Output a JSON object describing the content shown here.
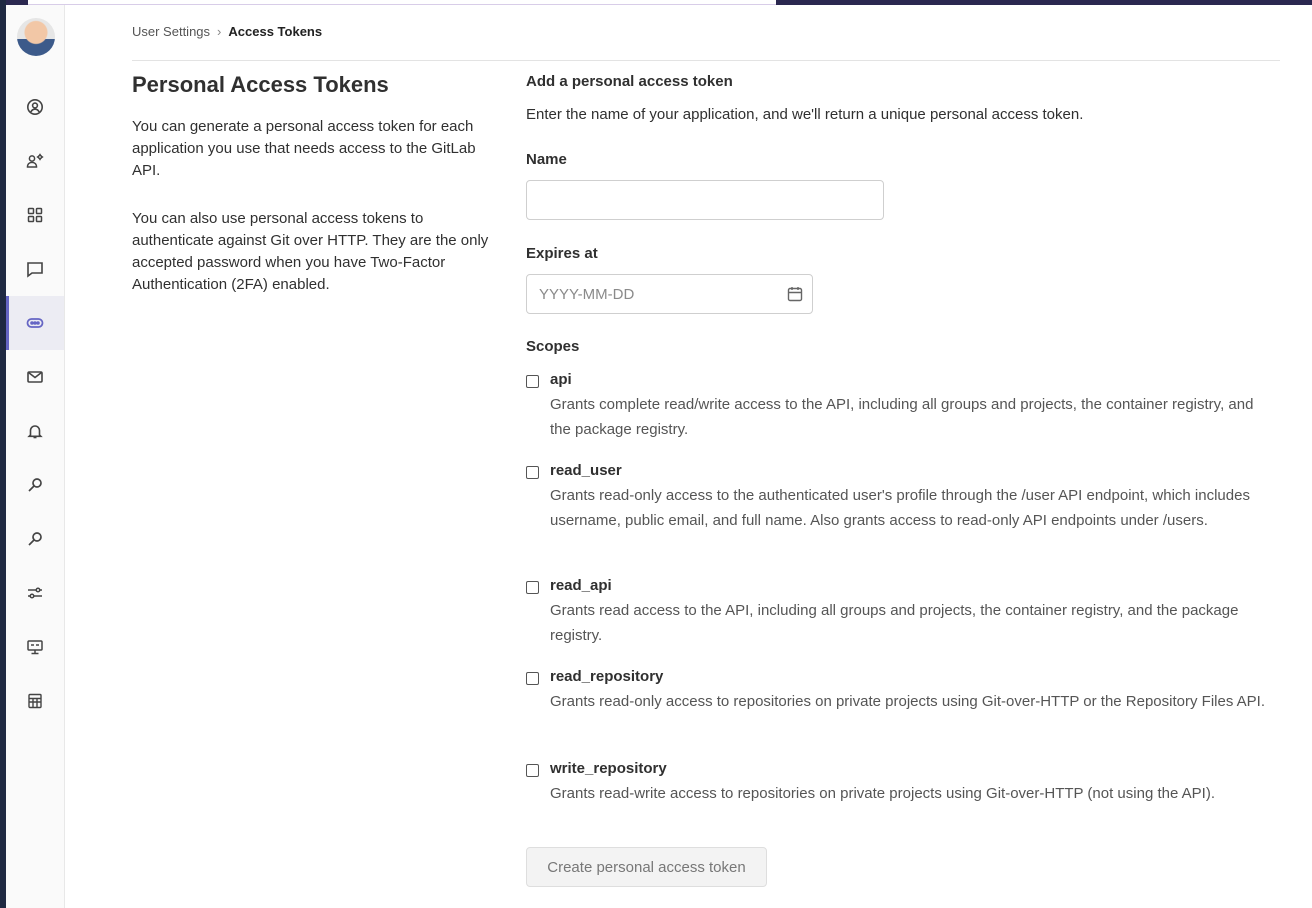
{
  "breadcrumb": {
    "parent": "User Settings",
    "separator": "›",
    "current": "Access Tokens"
  },
  "sidebar": {
    "items": [
      {
        "icon": "profile-icon"
      },
      {
        "icon": "account-icon"
      },
      {
        "icon": "applications-icon"
      },
      {
        "icon": "chat-icon"
      },
      {
        "icon": "access-tokens-icon",
        "active": true
      },
      {
        "icon": "emails-icon"
      },
      {
        "icon": "notifications-icon"
      },
      {
        "icon": "ssh-keys-icon"
      },
      {
        "icon": "gpg-keys-icon"
      },
      {
        "icon": "preferences-icon"
      },
      {
        "icon": "active-sessions-icon"
      },
      {
        "icon": "authentication-log-icon"
      }
    ]
  },
  "intro": {
    "title": "Personal Access Tokens",
    "paragraph1": "You can generate a personal access token for each application you use that needs access to the GitLab API.",
    "paragraph2": "You can also use personal access tokens to authenticate against Git over HTTP. They are the only accepted password when you have Two-Factor Authentication (2FA) enabled."
  },
  "form": {
    "title": "Add a personal access token",
    "description": "Enter the name of your application, and we'll return a unique personal access token.",
    "name_label": "Name",
    "name_value": "",
    "expires_label": "Expires at",
    "expires_placeholder": "YYYY-MM-DD",
    "scopes_label": "Scopes",
    "scopes": [
      {
        "name": "api",
        "checked": false,
        "description": "Grants complete read/write access to the API, including all groups and projects, the container registry, and the package registry."
      },
      {
        "name": "read_user",
        "checked": false,
        "description": "Grants read-only access to the authenticated user's profile through the /user API endpoint, which includes username, public email, and full name. Also grants access to read-only API endpoints under /users."
      },
      {
        "name": "read_api",
        "checked": false,
        "description": "Grants read access to the API, including all groups and projects, the container registry, and the package registry."
      },
      {
        "name": "read_repository",
        "checked": false,
        "description": "Grants read-only access to repositories on private projects using Git-over-HTTP or the Repository Files API."
      },
      {
        "name": "write_repository",
        "checked": false,
        "description": "Grants read-write access to repositories on private projects using Git-over-HTTP (not using the API)."
      }
    ],
    "submit_label": "Create personal access token"
  }
}
